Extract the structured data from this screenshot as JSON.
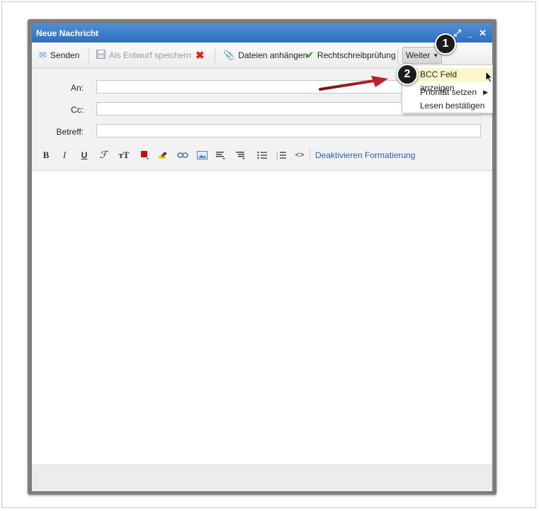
{
  "window": {
    "title": "Neue Nachricht",
    "icons": [
      "expand-icon",
      "minimize-icon",
      "close-icon"
    ]
  },
  "toolbar": {
    "send_label": "Senden",
    "draft_label": "Als Entwurf speichern",
    "attach_label": "Dateien anhängen",
    "spellcheck_label": "Rechtschreibprüfung",
    "more_label": "Weiter"
  },
  "form": {
    "to_label": "An:",
    "cc_label": "Cc:",
    "subject_label": "Betreff:",
    "to_value": "",
    "cc_value": "",
    "subject_value": ""
  },
  "format": {
    "bold": "B",
    "italic": "I",
    "underline": "U",
    "disable_link": "Deaktivieren Formatierung"
  },
  "dropdown": {
    "items": [
      {
        "label": "BCC Feld anzeigen",
        "highlighted": true
      },
      {
        "label": "Priorität setzen",
        "submenu": true
      },
      {
        "label": "Lesen bestätigen"
      }
    ]
  },
  "annotations": {
    "badge1": "1",
    "badge2": "2"
  },
  "colors": {
    "title_bar": "#2f6fbf",
    "link": "#2a5db0",
    "highlight": "#fcf6c8",
    "arrow": "#a01c22",
    "delete_red": "#d8231e",
    "check_green": "#3aa530"
  }
}
